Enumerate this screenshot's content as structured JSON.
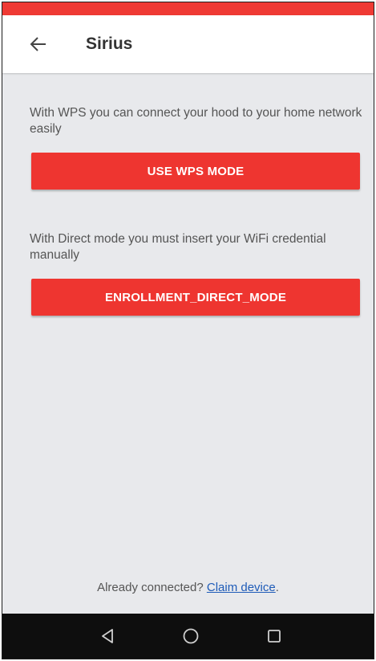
{
  "colors": {
    "accent": "#ee3530",
    "status_strip": "#ef3a34",
    "content_background": "#e8e9ec",
    "link": "#1e5bb8",
    "nav_bar": "#0e0e0e"
  },
  "app_bar": {
    "back_icon": "arrow-left-icon",
    "title": "Sirius"
  },
  "main": {
    "wps_description": "With WPS you can connect your hood to your home network easily",
    "wps_button_label": "USE WPS MODE",
    "direct_description": "With Direct mode you must insert your WiFi credential manually",
    "direct_button_label": "ENROLLMENT_DIRECT_MODE"
  },
  "footer": {
    "prefix": "Already connected? ",
    "link_label": "Claim device",
    "suffix": "."
  },
  "nav_bar": {
    "back_icon": "triangle-back-icon",
    "home_icon": "circle-home-icon",
    "recents_icon": "square-recents-icon"
  }
}
